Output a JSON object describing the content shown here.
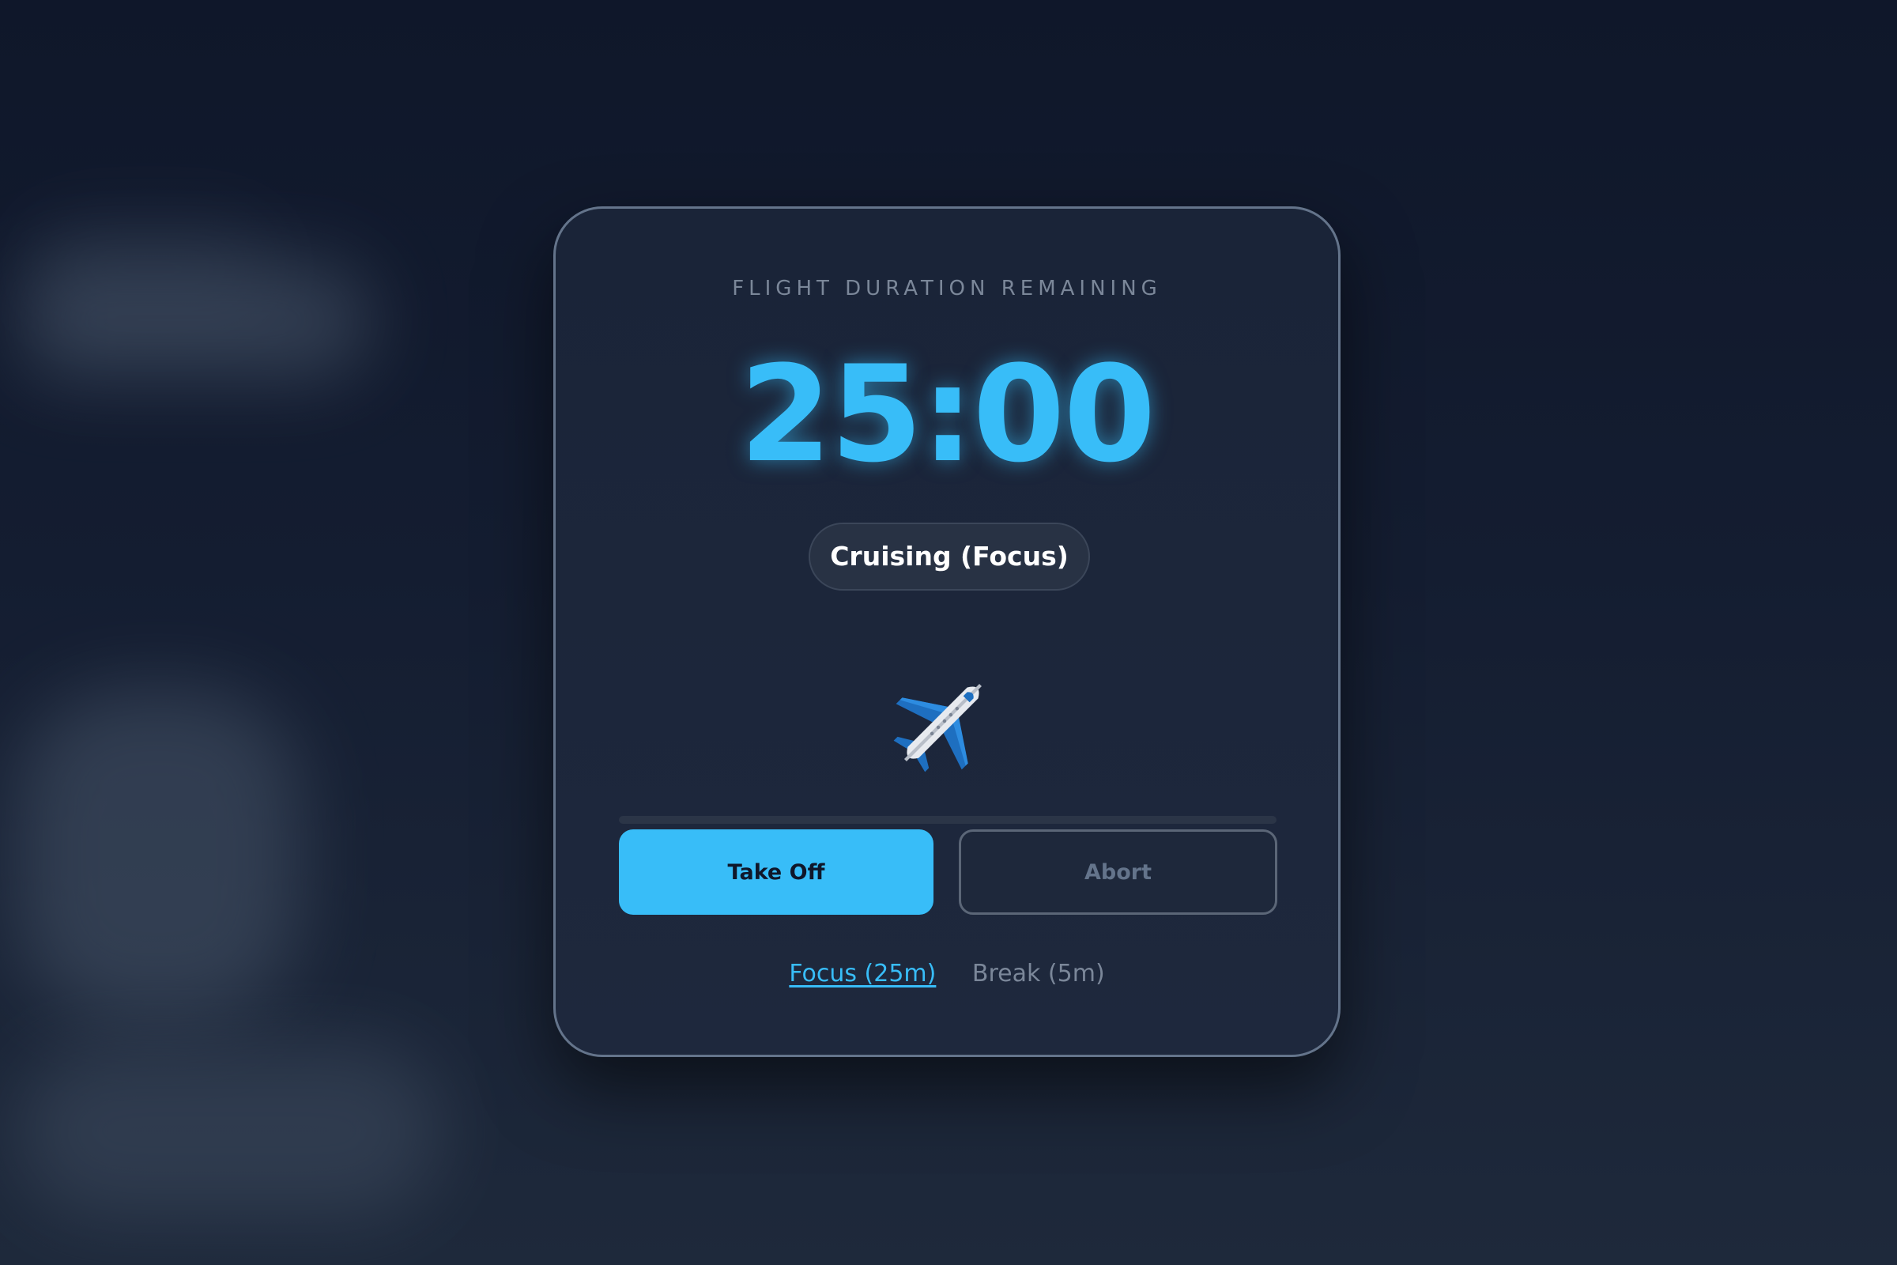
{
  "timer_card": {
    "label": "FLIGHT DURATION REMAINING",
    "time": "25:00",
    "status": "Cruising (Focus)",
    "plane_icon": "airplane-icon",
    "progress_fraction": 0.0
  },
  "controls": {
    "take_off_label": "Take Off",
    "abort_label": "Abort"
  },
  "modes": {
    "focus_label": "Focus (25m)",
    "break_label": "Break (5m)",
    "active": "focus"
  },
  "colors": {
    "accent": "#38bdf8",
    "background": "#0f172a",
    "card": "#1e293b"
  }
}
